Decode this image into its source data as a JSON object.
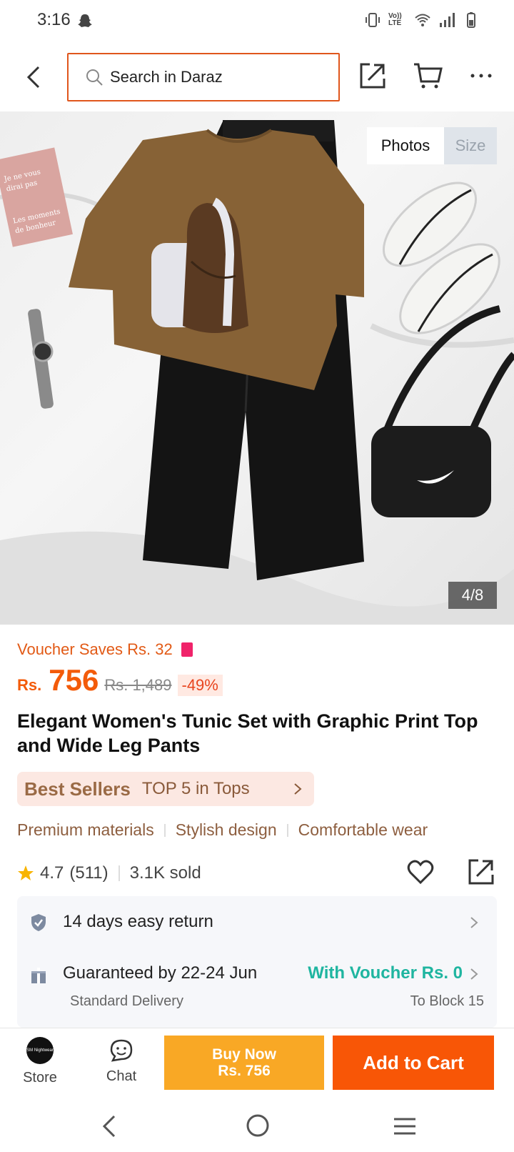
{
  "status_bar": {
    "time": "3:16",
    "lte_label": "Vo)) LTE"
  },
  "header": {
    "search_placeholder": "Search in Daraz"
  },
  "gallery": {
    "tabs": [
      "Photos",
      "Size"
    ],
    "active_tab": "Photos",
    "counter": "4/8",
    "notebook_text": "Je ne vous dirai pas ... Les moments de bonheur"
  },
  "product": {
    "voucher_text": "Voucher Saves Rs. 32",
    "currency": "Rs.",
    "price": "756",
    "original_price": "Rs. 1,489",
    "discount": "-49%",
    "title": "Elegant Women's Tunic Set with Graphic Print Top and Wide Leg Pants",
    "bestseller_badge": "Best Sellers",
    "bestseller_text": "TOP 5 in Tops",
    "features": [
      "Premium materials",
      "Stylish design",
      "Comfortable wear"
    ],
    "rating": "4.7",
    "reviews": "(511)",
    "sold": "3.1K sold"
  },
  "service": {
    "return_text": "14 days easy return",
    "delivery_text": "Guaranteed by 22-24 Jun",
    "voucher_text": "With Voucher Rs. 0",
    "delivery_type": "Standard Delivery",
    "location": "To Block 15"
  },
  "bottom_bar": {
    "store_label": "Store",
    "store_logo_text": "SM Nightwear",
    "chat_label": "Chat",
    "buy_now_label": "Buy Now",
    "buy_now_price": "Rs. 756",
    "add_to_cart_label": "Add to Cart"
  },
  "colors": {
    "accent_orange": "#f85606",
    "buy_now_yellow": "#f9a825",
    "price_orange": "#f35b0a",
    "voucher_teal": "#1fb5a0"
  }
}
